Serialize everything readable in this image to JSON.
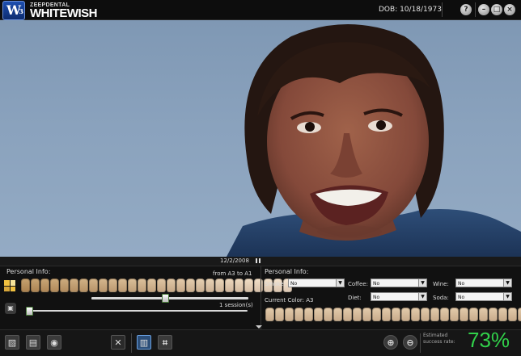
{
  "app": {
    "logo_top": "ZEEPDENTAL",
    "logo_main": "WHITEWISH",
    "logo_mark": "W",
    "logo_mark_sub": "3",
    "dob": "DOB: 10/18/1973",
    "help_label": "?",
    "minimize_label": "–",
    "maximize_label": "□",
    "close_label": "×"
  },
  "panel": {
    "date": "12/2/2008",
    "left": {
      "heading": "Personal Info:",
      "range_label": "from A3  to A1",
      "sessions_label": "1 session(s)",
      "whitening_slider_value": 0.47,
      "session_slider_value": 0.0
    },
    "right": {
      "heading": "Personal Info:",
      "smoke_label": "Smoke:",
      "smoke_value": "No",
      "coffee_label": "Coffee:",
      "coffee_value": "No",
      "wine_label": "Wine:",
      "wine_value": "No",
      "diet_label": "Diet:",
      "diet_value": "No",
      "soda_label": "Soda:",
      "soda_value": "No",
      "current_color_label": "Current Color: A3"
    }
  },
  "toolbar": {
    "estimated_label_1": "Estimated",
    "estimated_label_2": "success rate:",
    "success_rate": "73%"
  },
  "colors": {
    "accent_green": "#31d14a",
    "photo_bg": "#8aa2bd"
  }
}
